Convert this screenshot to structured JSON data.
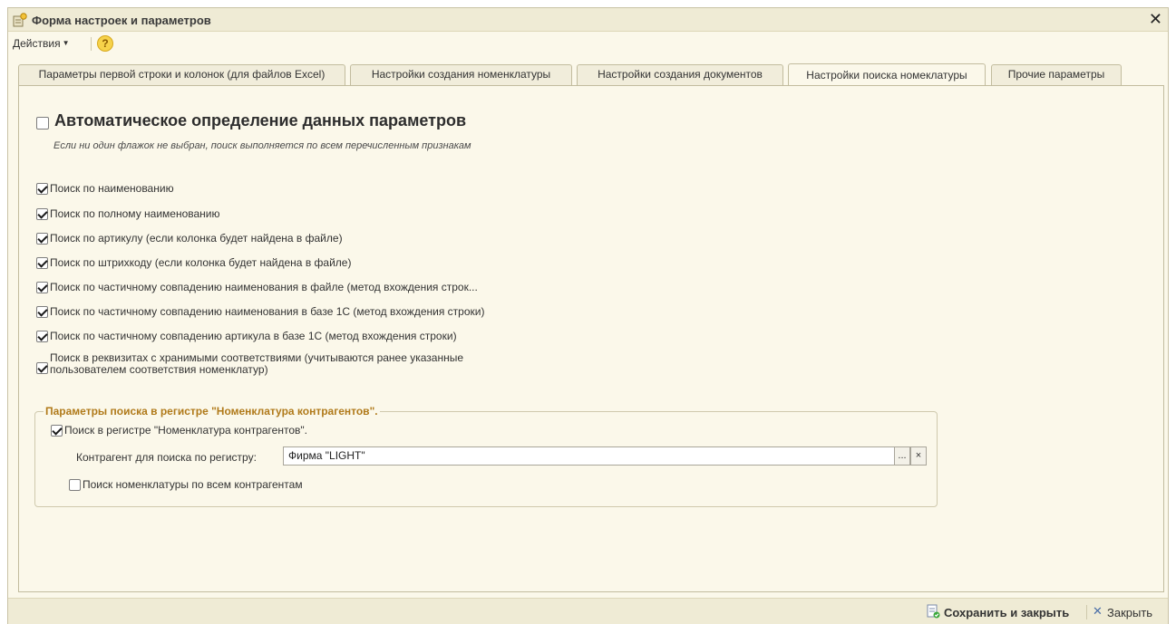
{
  "window": {
    "title": "Форма настроек и параметров"
  },
  "toolbar": {
    "actions_label": "Действия",
    "help_label": "?"
  },
  "tabs": [
    {
      "label": "Параметры первой строки и колонок (для файлов Excel)"
    },
    {
      "label": "Настройки создания номенклатуры"
    },
    {
      "label": "Настройки создания документов"
    },
    {
      "label": "Настройки поиска номеклатуры"
    },
    {
      "label": "Прочие параметры"
    }
  ],
  "active_tab": 3,
  "auto": {
    "label": "Автоматическое определение данных параметров",
    "checked": false,
    "hint": "Если ни один флажок не выбран, поиск выполняется по всем перечисленным признакам"
  },
  "options": [
    {
      "label": "Поиск по наименованию",
      "checked": true
    },
    {
      "label": "Поиск по полному наименованию",
      "checked": true
    },
    {
      "label": "Поиск по артикулу (если колонка будет найдена в файле)",
      "checked": true
    },
    {
      "label": "Поиск по штрихкоду (если колонка будет найдена в файле)",
      "checked": true
    },
    {
      "label": "Поиск по частичному совпадению наименования в файле (метод вхождения строк...",
      "checked": true
    },
    {
      "label": "Поиск по частичному совпадению наименования в базе 1С (метод вхождения строки)",
      "checked": true
    },
    {
      "label": "Поиск по частичному совпадению артикула в базе 1С (метод вхождения строки)",
      "checked": true
    },
    {
      "label_line1": "Поиск в реквизитах с хранимыми соответствиями (учитываются ранее указанные",
      "label_line2": "пользователем соответствия номенклатур)",
      "checked": true
    }
  ],
  "registry_group": {
    "title": "Параметры поиска в регистре \"Номенклатура контрагентов\".",
    "search_in_registry": {
      "label": "Поиск в регистре \"Номенклатура контрагентов\".",
      "checked": true
    },
    "counterparty_label": "Контрагент для поиска по регистру:",
    "counterparty_value": "Фирма \"LIGHT\"",
    "select_btn": "...",
    "clear_btn": "×",
    "all_counterparties": {
      "label": "Поиск номенклатуры по всем контрагентам",
      "checked": false
    }
  },
  "footer": {
    "save_close_label": "Сохранить и закрыть",
    "close_label": "Закрыть"
  },
  "colors": {
    "background": "#fbf8ea",
    "group_title": "#b07a1a",
    "titlebar": "#efebd5"
  }
}
